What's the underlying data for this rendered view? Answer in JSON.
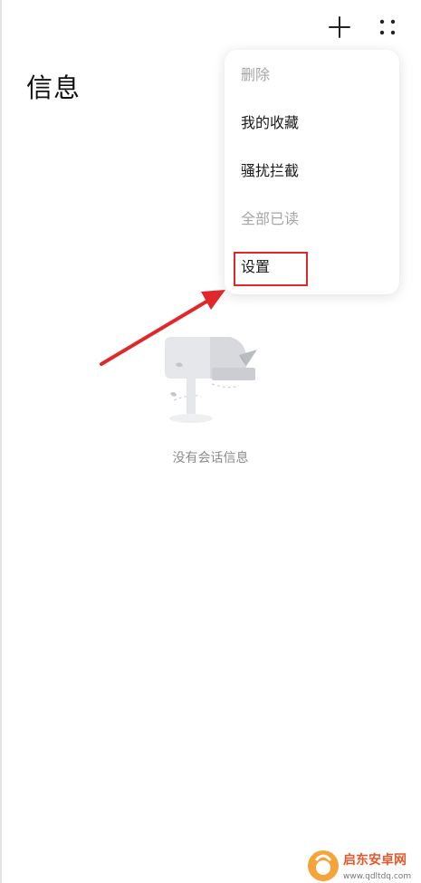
{
  "header": {
    "title": "信息",
    "actions": [
      {
        "name": "add",
        "icon": "plus-icon"
      },
      {
        "name": "more",
        "icon": "more-dots-icon"
      }
    ]
  },
  "menu": {
    "items": [
      {
        "label": "删除",
        "enabled": false
      },
      {
        "label": "我的收藏",
        "enabled": true
      },
      {
        "label": "骚扰拦截",
        "enabled": true
      },
      {
        "label": "全部已读",
        "enabled": false
      },
      {
        "label": "设置",
        "enabled": true,
        "highlighted": true
      }
    ]
  },
  "empty_state": {
    "icon": "mailbox-icon",
    "text": "没有会话信息"
  },
  "watermark": {
    "brand": "启东安卓网",
    "url": "www.qdltdq.com"
  },
  "colors": {
    "annotation_red": "#e0282a",
    "disabled_text": "#a6a6a6",
    "empty_text": "#8c8c8c"
  }
}
